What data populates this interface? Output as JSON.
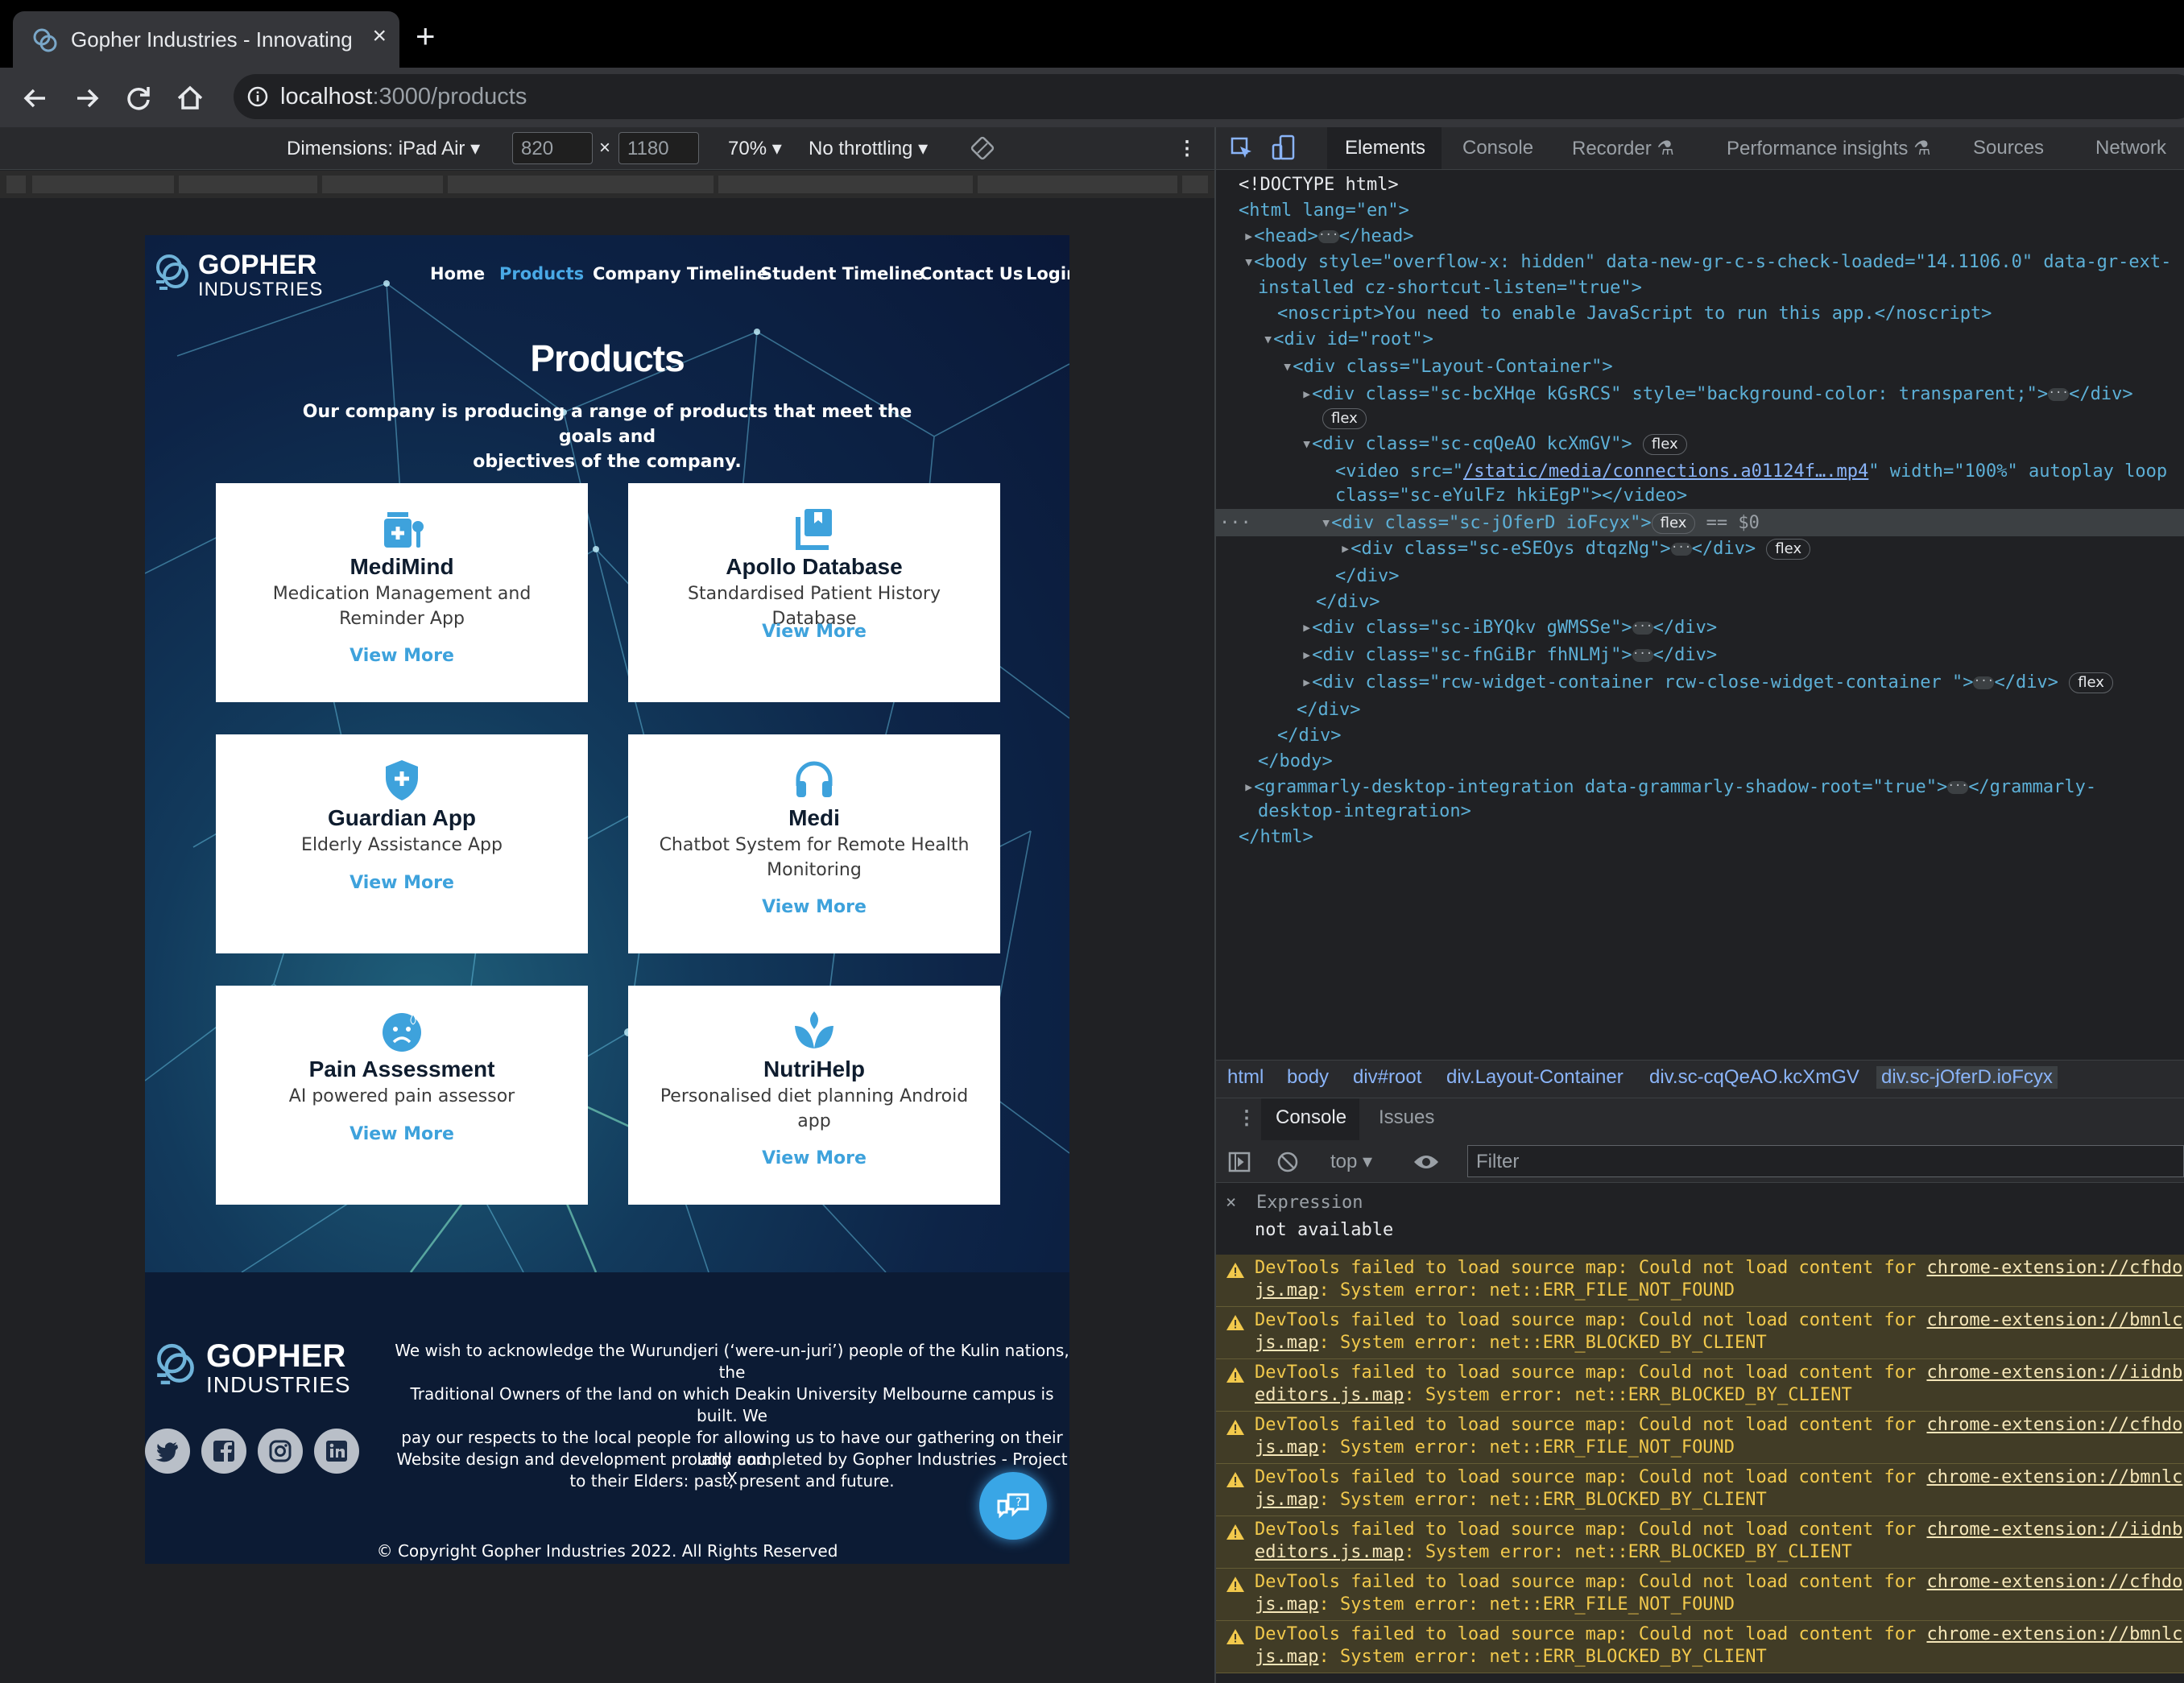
{
  "browser": {
    "tab_title": "Gopher Industries - Innovating",
    "url_host": "localhost",
    "url_path": ":3000/products"
  },
  "device_toolbar": {
    "dimensions_label": "Dimensions: iPad Air",
    "width": "820",
    "height": "1180",
    "times": "×",
    "zoom": "70%",
    "throttling": "No throttling"
  },
  "site": {
    "logo_word1": "GOPHER",
    "logo_word2": "INDUSTRIES",
    "nav": [
      "Home",
      "Products",
      "Company Timeline",
      "Student Timeline",
      "Contact Us",
      "Login"
    ],
    "active_nav": "Products",
    "heading": "Products",
    "intro_line1": "Our company is producing a range of products that meet the goals and",
    "intro_line2": "objectives of the company.",
    "products": [
      {
        "name": "MediMind",
        "desc1": "Medication Management and",
        "desc2": "Reminder App",
        "link": "View More",
        "icon": "medication-icon"
      },
      {
        "name": "Apollo Database",
        "desc1": "Standardised Patient History Database",
        "desc2": "",
        "link": "View More",
        "icon": "database-icon"
      },
      {
        "name": "Guardian App",
        "desc1": "Elderly Assistance App",
        "desc2": "",
        "link": "View More",
        "icon": "shield-icon"
      },
      {
        "name": "Medi",
        "desc1": "Chatbot System for Remote Health",
        "desc2": "Monitoring",
        "link": "View More",
        "icon": "headset-icon"
      },
      {
        "name": "Pain Assessment",
        "desc1": "AI powered pain assessor",
        "desc2": "",
        "link": "View More",
        "icon": "sad-face-icon"
      },
      {
        "name": "NutriHelp",
        "desc1": "Personalised diet planning Android",
        "desc2": "app",
        "link": "View More",
        "icon": "seedling-icon"
      }
    ],
    "footer": {
      "ack_line1": "We wish to acknowledge the Wurundjeri (‘were-un-juri’) people of the Kulin nations, the",
      "ack_line2": "Traditional Owners of the land on which Deakin University Melbourne campus is built. We",
      "ack_line3": "pay our respects to the local people for allowing us to have our gathering on their land and",
      "ack_line4": "to their Elders: past, present and future.",
      "credit": "Website design and development proudly completed by Gopher Industries - Project X",
      "copyright": "© Copyright Gopher Industries 2022. All Rights Reserved",
      "social": [
        "twitter-icon",
        "facebook-icon",
        "instagram-icon",
        "linkedin-icon"
      ]
    }
  },
  "devtools": {
    "tabs": [
      "Elements",
      "Console",
      "Recorder",
      "Performance insights",
      "Sources",
      "Network"
    ],
    "active_tab": "Elements",
    "dom": {
      "l1": "<!DOCTYPE html>",
      "html_open": "<html lang=\"en\">",
      "head": "<head>",
      "head_close": "</head>",
      "body_open": "<body style=\"overflow-x: hidden\" data-new-gr-c-s-check-loaded=\"14.1106.0\" data-gr-ext-",
      "body_open2": "installed cz-shortcut-listen=\"true\">",
      "noscript": "<noscript>You need to enable JavaScript to run this app.</noscript>",
      "root": "<div id=\"root\">",
      "layout": "<div class=\"Layout-Container\">",
      "bcx": "<div class=\"sc-bcXHqe kGsRCS\" style=\"background-color: transparent;\">",
      "div_close": "</div>",
      "cqq": "<div class=\"sc-cqQeAO kcXmGV\">",
      "video": "<video src=\"",
      "video_src": "/static/media/connections.a01124f….mp4",
      "video_rest": "\" width=\"100%\" autoplay loop",
      "video2": "class=\"sc-eYulFz hkiEgP\"></video>",
      "jof": "<div class=\"sc-jOferD ioFcyx\">",
      "eq": "== $0",
      "ese": "<div class=\"sc-eSEOys dtqzNg\">",
      "iby": "<div class=\"sc-iBYQkv gWMSSe\">",
      "fng": "<div class=\"sc-fnGiBr fhNLMj\">",
      "rcw": "<div class=\"rcw-widget-container rcw-close-widget-container \">",
      "body_close": "</body>",
      "gram": "<grammarly-desktop-integration data-grammarly-shadow-root=\"true\">",
      "gram_close": "</grammarly-",
      "gram_close2": "desktop-integration>",
      "html_close": "</html>",
      "flex": "flex"
    },
    "breadcrumbs": [
      "html",
      "body",
      "div#root",
      "div.Layout-Container",
      "div.sc-cqQeAO.kcXmGV",
      "div.sc-jOferD.ioFcyx"
    ],
    "drawer_tabs": [
      "Console",
      "Issues"
    ],
    "context": "top",
    "filter_placeholder": "Filter",
    "expression_label": "Expression",
    "expression_value": "not available",
    "messages": [
      {
        "line1": "DevTools failed to load source map: Could not load content for ",
        "link": "chrome-extension://cfhdo",
        "line2a": "js.map",
        "line2b": ": System error: net::ERR_FILE_NOT_FOUND"
      },
      {
        "line1": "DevTools failed to load source map: Could not load content for ",
        "link": "chrome-extension://bmnlc",
        "line2a": "js.map",
        "line2b": ": System error: net::ERR_BLOCKED_BY_CLIENT"
      },
      {
        "line1": "DevTools failed to load source map: Could not load content for ",
        "link": "chrome-extension://iidnb",
        "line2a": "editors.js.map",
        "line2b": ": System error: net::ERR_BLOCKED_BY_CLIENT"
      },
      {
        "line1": "DevTools failed to load source map: Could not load content for ",
        "link": "chrome-extension://cfhdo",
        "line2a": "js.map",
        "line2b": ": System error: net::ERR_FILE_NOT_FOUND"
      },
      {
        "line1": "DevTools failed to load source map: Could not load content for ",
        "link": "chrome-extension://bmnlc",
        "line2a": "js.map",
        "line2b": ": System error: net::ERR_BLOCKED_BY_CLIENT"
      },
      {
        "line1": "DevTools failed to load source map: Could not load content for ",
        "link": "chrome-extension://iidnb",
        "line2a": "editors.js.map",
        "line2b": ": System error: net::ERR_BLOCKED_BY_CLIENT"
      },
      {
        "line1": "DevTools failed to load source map: Could not load content for ",
        "link": "chrome-extension://cfhdo",
        "line2a": "js.map",
        "line2b": ": System error: net::ERR_FILE_NOT_FOUND"
      },
      {
        "line1": "DevTools failed to load source map: Could not load content for ",
        "link": "chrome-extension://bmnlc",
        "line2a": "js.map",
        "line2b": ": System error: net::ERR_BLOCKED_BY_CLIENT"
      }
    ]
  },
  "colors": {
    "accent": "#49a9e6",
    "card_link": "#3ea2dc",
    "warning_bg": "#413c26"
  }
}
